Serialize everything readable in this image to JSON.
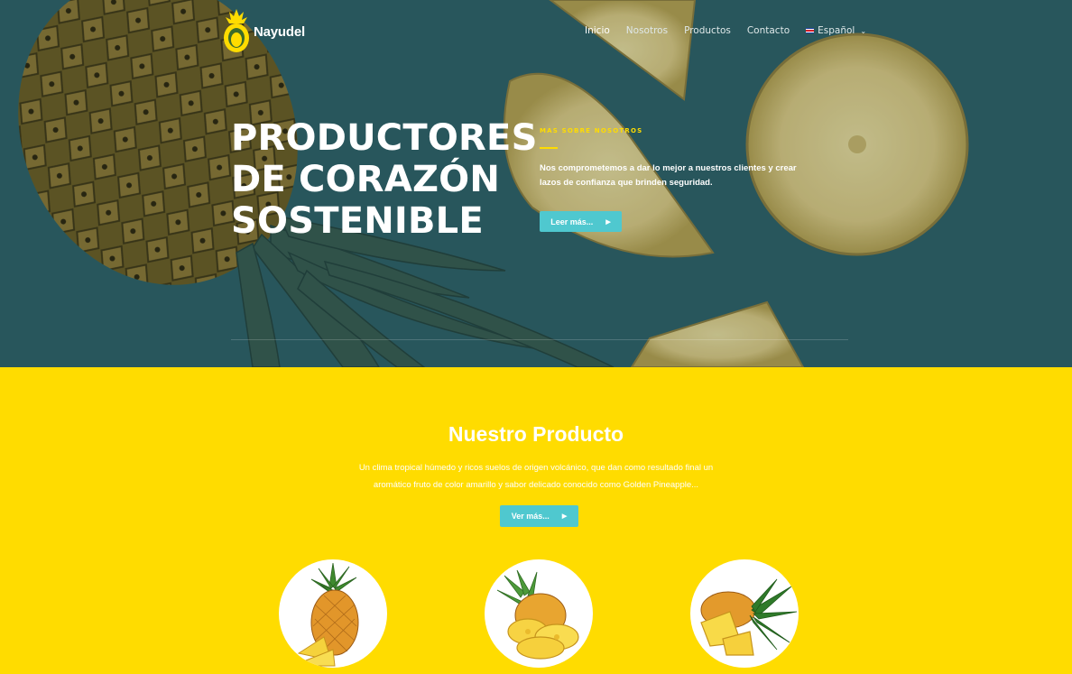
{
  "brand": {
    "name": "Nayudel",
    "logo_icon": "pineapple-face-logo"
  },
  "nav": {
    "items": [
      {
        "label": "Inicio",
        "active": true
      },
      {
        "label": "Nosotros",
        "active": false
      },
      {
        "label": "Productos",
        "active": false
      },
      {
        "label": "Contacto",
        "active": false
      }
    ],
    "language": {
      "label": "Español",
      "icon": "costa-rica-flag-icon"
    }
  },
  "hero": {
    "title_lines": [
      "PRODUCTORES",
      "DE CORAZÓN",
      "SOSTENIBLE"
    ],
    "eyebrow": "MAS SOBRE NOSOTROS",
    "description": "Nos comprometemos a dar lo mejor a nuestros clientes y crear lazos de confianza que brinden seguridad.",
    "button_label": "Leer más...",
    "button_icon": "arrow-right-icon"
  },
  "product_section": {
    "title": "Nuestro Producto",
    "description": "Un clima tropical húmedo y ricos suelos de origen volcánico, que dan como resultado final un aromático fruto de color amarillo y sabor delicado conocido como Golden Pineapple...",
    "button_label": "Ver más...",
    "button_icon": "arrow-right-icon",
    "images": [
      "whole-pineapple-image",
      "sliced-pineapple-image",
      "pineapple-with-slices-image"
    ]
  },
  "colors": {
    "brand_yellow": "#ffdc00",
    "accent_teal": "#4fc8cf",
    "hero_bg": "#2b5d63"
  }
}
